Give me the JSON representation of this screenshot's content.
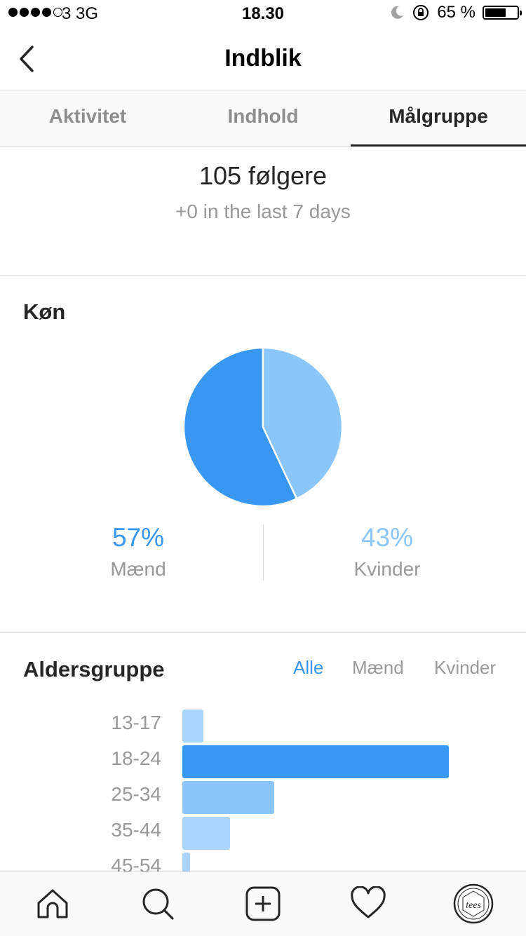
{
  "status_bar": {
    "signal_filled": 4,
    "signal_total": 5,
    "carrier": "3   3G",
    "time": "18.30",
    "battery_text": "65 %",
    "battery_level": 0.65
  },
  "nav": {
    "title": "Indblik"
  },
  "tabs": [
    {
      "label": "Aktivitet",
      "active": false
    },
    {
      "label": "Indhold",
      "active": false
    },
    {
      "label": "Målgruppe",
      "active": true
    }
  ],
  "followers": {
    "count_text": "105 følgere",
    "delta_text": "+0 in the last 7 days"
  },
  "gender": {
    "title": "Køn",
    "stats": [
      {
        "percent_text": "57%",
        "label": "Mænd",
        "color": "#3897f0"
      },
      {
        "percent_text": "43%",
        "label": "Kvinder",
        "color": "#8bc6fb"
      }
    ]
  },
  "age": {
    "title": "Aldersgruppe",
    "filters": [
      {
        "label": "Alle",
        "active": true
      },
      {
        "label": "Mænd",
        "active": false
      },
      {
        "label": "Kvinder",
        "active": false
      }
    ],
    "groups": [
      {
        "label": "13-17",
        "share": 0.08,
        "color": "#a8d4fd"
      },
      {
        "label": "18-24",
        "share": 1.0,
        "color": "#3897f0"
      },
      {
        "label": "25-34",
        "share": 0.345,
        "color": "#8bc6fb"
      },
      {
        "label": "35-44",
        "share": 0.18,
        "color": "#a8d4fd"
      },
      {
        "label": "45-54",
        "share": 0.03,
        "color": "#a8d4fd"
      }
    ]
  },
  "chart_data": [
    {
      "type": "pie",
      "title": "Køn",
      "categories": [
        "Mænd",
        "Kvinder"
      ],
      "values": [
        57,
        43
      ],
      "colors": [
        "#3897f0",
        "#8bc6fb"
      ]
    },
    {
      "type": "bar",
      "title": "Aldersgruppe",
      "orientation": "horizontal",
      "categories": [
        "13-17",
        "18-24",
        "25-34",
        "35-44",
        "45-54"
      ],
      "values": [
        8,
        100,
        34.5,
        18,
        3
      ],
      "grid": false
    }
  ],
  "bottom_nav": [
    {
      "icon": "home-icon"
    },
    {
      "icon": "search-icon"
    },
    {
      "icon": "add-post-icon"
    },
    {
      "icon": "heart-icon"
    },
    {
      "icon": "profile-avatar-icon",
      "logo_text": "tees"
    }
  ]
}
